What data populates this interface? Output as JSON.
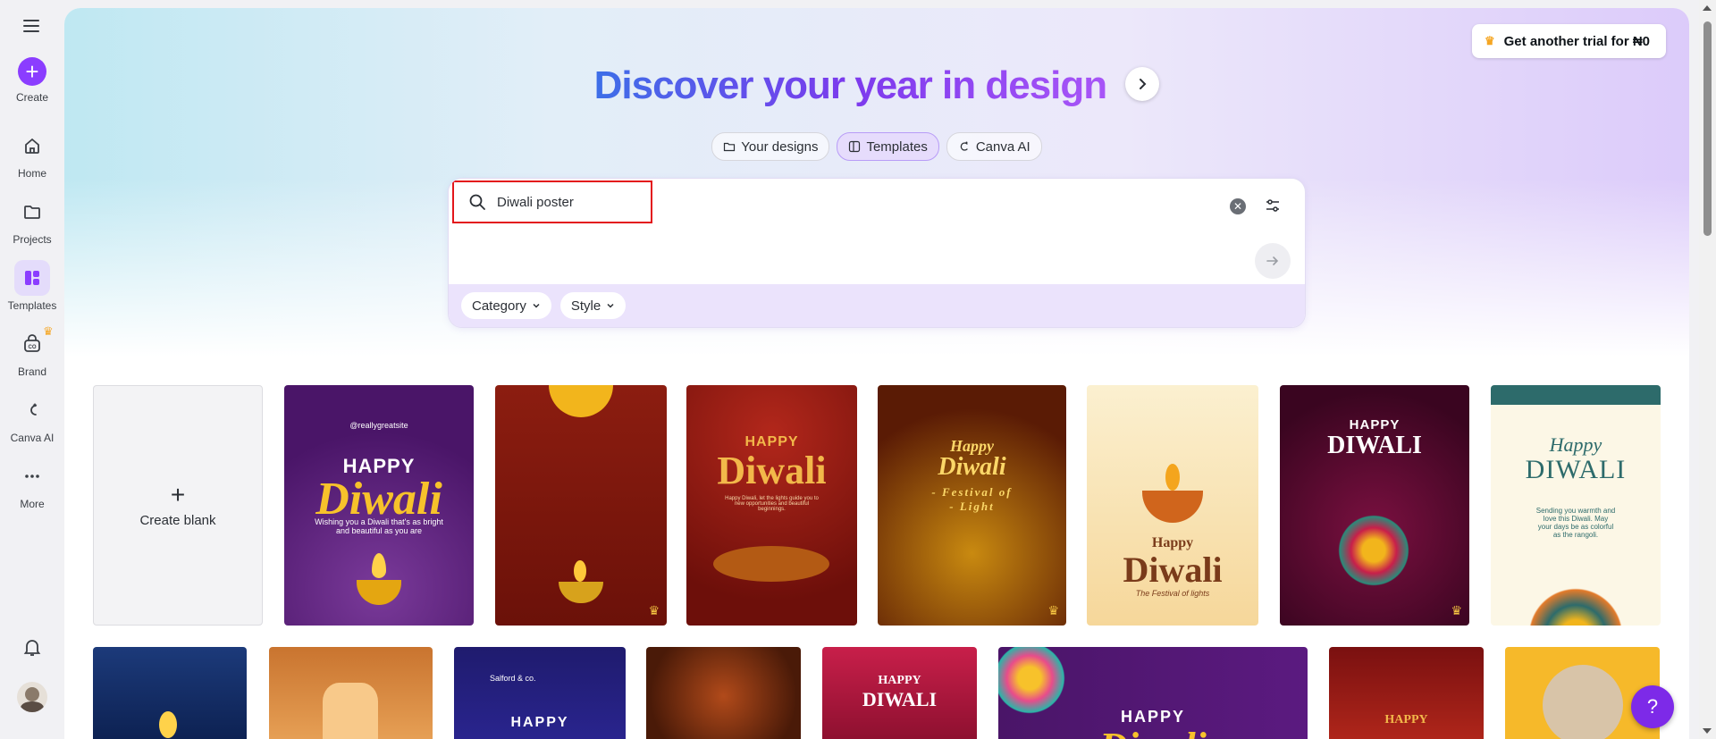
{
  "sidebar": {
    "create_label": "Create",
    "items": [
      {
        "label": "Home",
        "icon": "home-icon"
      },
      {
        "label": "Projects",
        "icon": "folder-icon"
      },
      {
        "label": "Templates",
        "icon": "templates-icon"
      },
      {
        "label": "Brand",
        "icon": "brand-icon"
      },
      {
        "label": "Canva AI",
        "icon": "canva-ai-icon"
      },
      {
        "label": "More",
        "icon": "more-icon"
      }
    ]
  },
  "header": {
    "trial_button": "Get another trial for ₦0",
    "title": "Discover your year in design"
  },
  "tabs": [
    {
      "label": "Your designs"
    },
    {
      "label": "Templates"
    },
    {
      "label": "Canva AI"
    }
  ],
  "search": {
    "value": "Diwali poster",
    "chips": [
      "Category",
      "Style"
    ]
  },
  "grid": {
    "create_blank_label": "Create blank",
    "row1": [
      {
        "site": "@reallygreatsite",
        "top": "HAPPY",
        "main": "Diwali",
        "sub": "Wishing you a Diwali that's as bright and beautiful as you are"
      },
      {
        "top": "",
        "main": "",
        "sub": ""
      },
      {
        "top": "HAPPY",
        "main": "Diwali",
        "sub": "Happy Diwali, let the lights guide you to new opportunities and beautiful beginnings."
      },
      {
        "top": "Happy",
        "main": "Diwali",
        "sub": "- Festival of - Light"
      },
      {
        "top": "Happy",
        "main": "Diwali",
        "sub": "The Festival of lights"
      },
      {
        "top": "HAPPY",
        "main": "DIWALI",
        "sub": ""
      },
      {
        "top": "Happy",
        "main": "DIWALI",
        "sub": "Sending you warmth and love this Diwali. May your days be as colorful as the rangoli."
      }
    ],
    "row2": [
      {
        "top": "",
        "main": ""
      },
      {
        "top": "",
        "main": ""
      },
      {
        "top": "Salford & co.",
        "main": "HAPPY"
      },
      {
        "top": "",
        "main": ""
      },
      {
        "top": "HAPPY",
        "main": "DIWALI"
      },
      {
        "top": "HAPPY",
        "main": "Diwali"
      },
      {
        "top": "",
        "main": "HAPPY"
      },
      {
        "top": "",
        "main": ""
      }
    ]
  },
  "help_label": "?",
  "colors": {
    "accent": "#8b3dff",
    "highlight": "#e3161b"
  }
}
